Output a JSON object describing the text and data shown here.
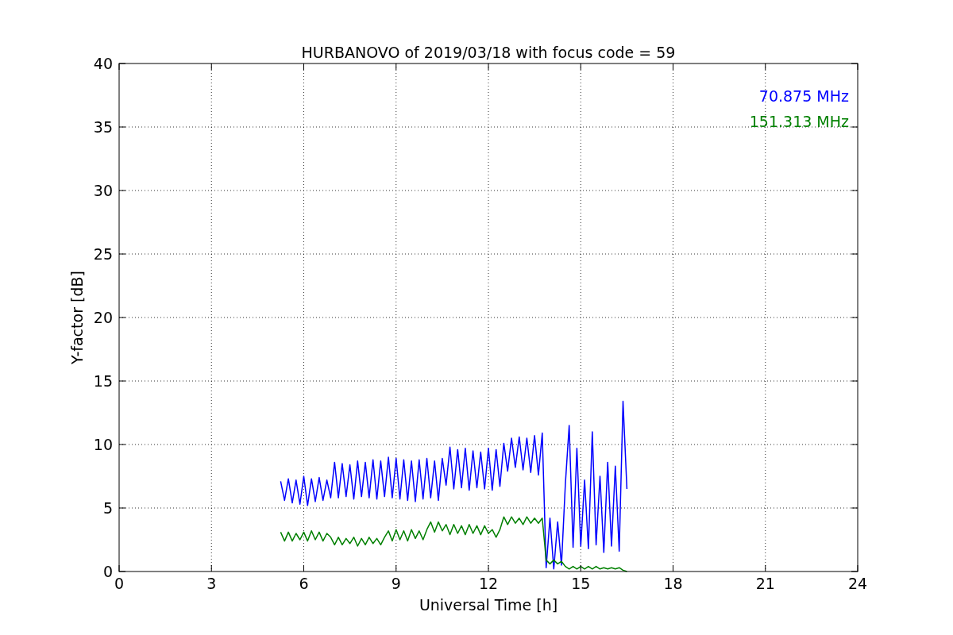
{
  "figure": {
    "chart_data": {
      "type": "line",
      "title": "HURBANOVO of 2019/03/18 with focus code = 59",
      "xlabel": "Universal Time [h]",
      "ylabel": "Y-factor [dB]",
      "x": [
        5.25,
        5.375,
        5.5,
        5.625,
        5.75,
        5.875,
        6.0,
        6.125,
        6.25,
        6.375,
        6.5,
        6.625,
        6.75,
        6.875,
        7.0,
        7.125,
        7.25,
        7.375,
        7.5,
        7.625,
        7.75,
        7.875,
        8.0,
        8.125,
        8.25,
        8.375,
        8.5,
        8.625,
        8.75,
        8.875,
        9.0,
        9.125,
        9.25,
        9.375,
        9.5,
        9.625,
        9.75,
        9.875,
        10.0,
        10.125,
        10.25,
        10.375,
        10.5,
        10.625,
        10.75,
        10.875,
        11.0,
        11.125,
        11.25,
        11.375,
        11.5,
        11.625,
        11.75,
        11.875,
        12.0,
        12.125,
        12.25,
        12.375,
        12.5,
        12.625,
        12.75,
        12.875,
        13.0,
        13.125,
        13.25,
        13.375,
        13.5,
        13.625,
        13.75,
        13.875,
        14.0,
        14.125,
        14.25,
        14.375,
        14.5,
        14.625,
        14.75,
        14.875,
        15.0,
        15.125,
        15.25,
        15.375,
        15.5,
        15.625,
        15.75,
        15.875,
        16.0,
        16.125,
        16.25,
        16.375,
        16.5
      ],
      "series": [
        {
          "name": "70.875 MHz",
          "color": "#0000ff",
          "values": [
            7.1,
            5.6,
            7.3,
            5.4,
            7.2,
            5.3,
            7.5,
            5.2,
            7.3,
            5.5,
            7.4,
            5.6,
            7.2,
            5.8,
            8.6,
            5.8,
            8.5,
            5.9,
            8.4,
            5.7,
            8.7,
            5.9,
            8.6,
            5.8,
            8.8,
            5.7,
            8.7,
            5.9,
            9.0,
            5.8,
            8.9,
            5.7,
            8.8,
            5.6,
            8.7,
            5.5,
            8.8,
            5.7,
            8.9,
            5.8,
            8.7,
            5.6,
            8.9,
            6.8,
            9.8,
            6.5,
            9.6,
            6.6,
            9.7,
            6.4,
            9.5,
            6.6,
            9.4,
            6.5,
            9.7,
            6.4,
            9.6,
            6.7,
            10.1,
            7.9,
            10.5,
            8.2,
            10.6,
            8.0,
            10.5,
            7.8,
            10.7,
            7.6,
            10.9,
            0.3,
            4.2,
            0.2,
            3.9,
            0.5,
            6.9,
            11.5,
            1.9,
            9.7,
            2.0,
            7.2,
            1.8,
            11.0,
            2.1,
            7.5,
            1.5,
            8.6,
            2.0,
            8.3,
            1.6,
            13.4,
            6.5
          ]
        },
        {
          "name": "151.313 MHz",
          "color": "#008000",
          "values": [
            3.1,
            2.4,
            3.1,
            2.4,
            3.0,
            2.5,
            3.1,
            2.4,
            3.2,
            2.5,
            3.1,
            2.4,
            3.0,
            2.7,
            2.1,
            2.7,
            2.1,
            2.6,
            2.2,
            2.7,
            2.0,
            2.6,
            2.1,
            2.7,
            2.2,
            2.6,
            2.1,
            2.7,
            3.2,
            2.4,
            3.3,
            2.5,
            3.2,
            2.4,
            3.3,
            2.6,
            3.2,
            2.5,
            3.3,
            3.9,
            3.1,
            3.9,
            3.2,
            3.7,
            2.9,
            3.7,
            3.0,
            3.6,
            2.9,
            3.7,
            3.0,
            3.6,
            2.9,
            3.6,
            3.0,
            3.3,
            2.7,
            3.3,
            4.3,
            3.7,
            4.3,
            3.8,
            4.2,
            3.7,
            4.3,
            3.8,
            4.2,
            3.8,
            4.2,
            0.9,
            0.6,
            0.9,
            0.6,
            0.8,
            0.4,
            0.2,
            0.4,
            0.2,
            0.4,
            0.2,
            0.4,
            0.2,
            0.4,
            0.2,
            0.3,
            0.2,
            0.3,
            0.2,
            0.3,
            0.1,
            0.0
          ]
        }
      ],
      "grid": true,
      "xlim": [
        0,
        24
      ],
      "ylim": [
        0,
        40
      ],
      "xticks": [
        0,
        3,
        6,
        9,
        12,
        15,
        18,
        21,
        24
      ],
      "yticks": [
        0,
        5,
        10,
        15,
        20,
        25,
        30,
        35,
        40
      ]
    }
  }
}
